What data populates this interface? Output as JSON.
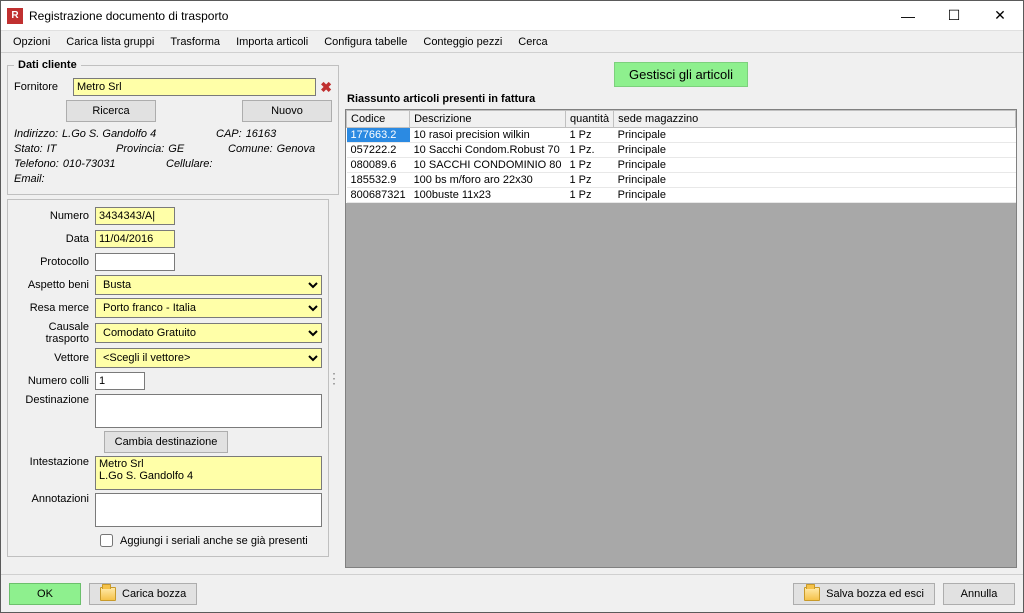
{
  "window": {
    "title": "Registrazione documento di trasporto"
  },
  "menu": [
    "Opzioni",
    "Carica lista gruppi",
    "Trasforma",
    "Importa articoli",
    "Configura tabelle",
    "Conteggio pezzi",
    "Cerca"
  ],
  "client": {
    "legend": "Dati cliente",
    "fornitore_label": "Fornitore",
    "fornitore": "Metro Srl",
    "ricerca": "Ricerca",
    "nuovo": "Nuovo",
    "indirizzo_k": "Indirizzo:",
    "indirizzo_v": "L.Go S. Gandolfo 4",
    "cap_k": "CAP:",
    "cap_v": "16163",
    "stato_k": "Stato:",
    "stato_v": "IT",
    "provincia_k": "Provincia:",
    "provincia_v": "GE",
    "comune_k": "Comune:",
    "comune_v": "Genova",
    "telefono_k": "Telefono:",
    "telefono_v": "010-73031",
    "cellulare_k": "Cellulare:",
    "cellulare_v": "",
    "email_k": "Email:",
    "email_v": ""
  },
  "form": {
    "numero_l": "Numero",
    "numero": "3434343/A|",
    "data_l": "Data",
    "data": "11/04/2016",
    "protocollo_l": "Protocollo",
    "protocollo": "",
    "aspetto_l": "Aspetto beni",
    "aspetto": "Busta",
    "resa_l": "Resa merce",
    "resa": "Porto franco - Italia",
    "causale_l": "Causale trasporto",
    "causale": "Comodato Gratuito",
    "vettore_l": "Vettore",
    "vettore": "<Scegli il vettore>",
    "colli_l": "Numero colli",
    "colli": "1",
    "dest_l": "Destinazione",
    "dest": "",
    "cambia_dest": "Cambia destinazione",
    "intest_l": "Intestazione",
    "intest": "Metro Srl\nL.Go S. Gandolfo 4",
    "annot_l": "Annotazioni",
    "annot": "",
    "chk_seriali": "Aggiungi i seriali anche se già presenti"
  },
  "articles": {
    "manage": "Gestisci gli articoli",
    "summary": "Riassunto articoli presenti in fattura",
    "cols": {
      "codice": "Codice",
      "descrizione": "Descrizione",
      "quantita": "quantità",
      "sede": "sede magazzino"
    },
    "rows": [
      {
        "codice": "177663.2",
        "desc": "10 rasoi precision wilkin",
        "qta": "1 Pz",
        "sede": "Principale",
        "sel": true
      },
      {
        "codice": "057222.2",
        "desc": "10 Sacchi Condom.Robust 70",
        "qta": "1 Pz.",
        "sede": "Principale"
      },
      {
        "codice": "080089.6",
        "desc": "10 SACCHI CONDOMINIO 80",
        "qta": "1 Pz",
        "sede": "Principale"
      },
      {
        "codice": "185532.9",
        "desc": "100 bs m/foro aro 22x30",
        "qta": "1 Pz",
        "sede": "Principale"
      },
      {
        "codice": "800687321",
        "desc": "100buste 11x23",
        "qta": "1 Pz",
        "sede": "Principale"
      }
    ]
  },
  "footer": {
    "ok": "OK",
    "carica": "Carica bozza",
    "salva": "Salva bozza ed esci",
    "annulla": "Annulla"
  }
}
